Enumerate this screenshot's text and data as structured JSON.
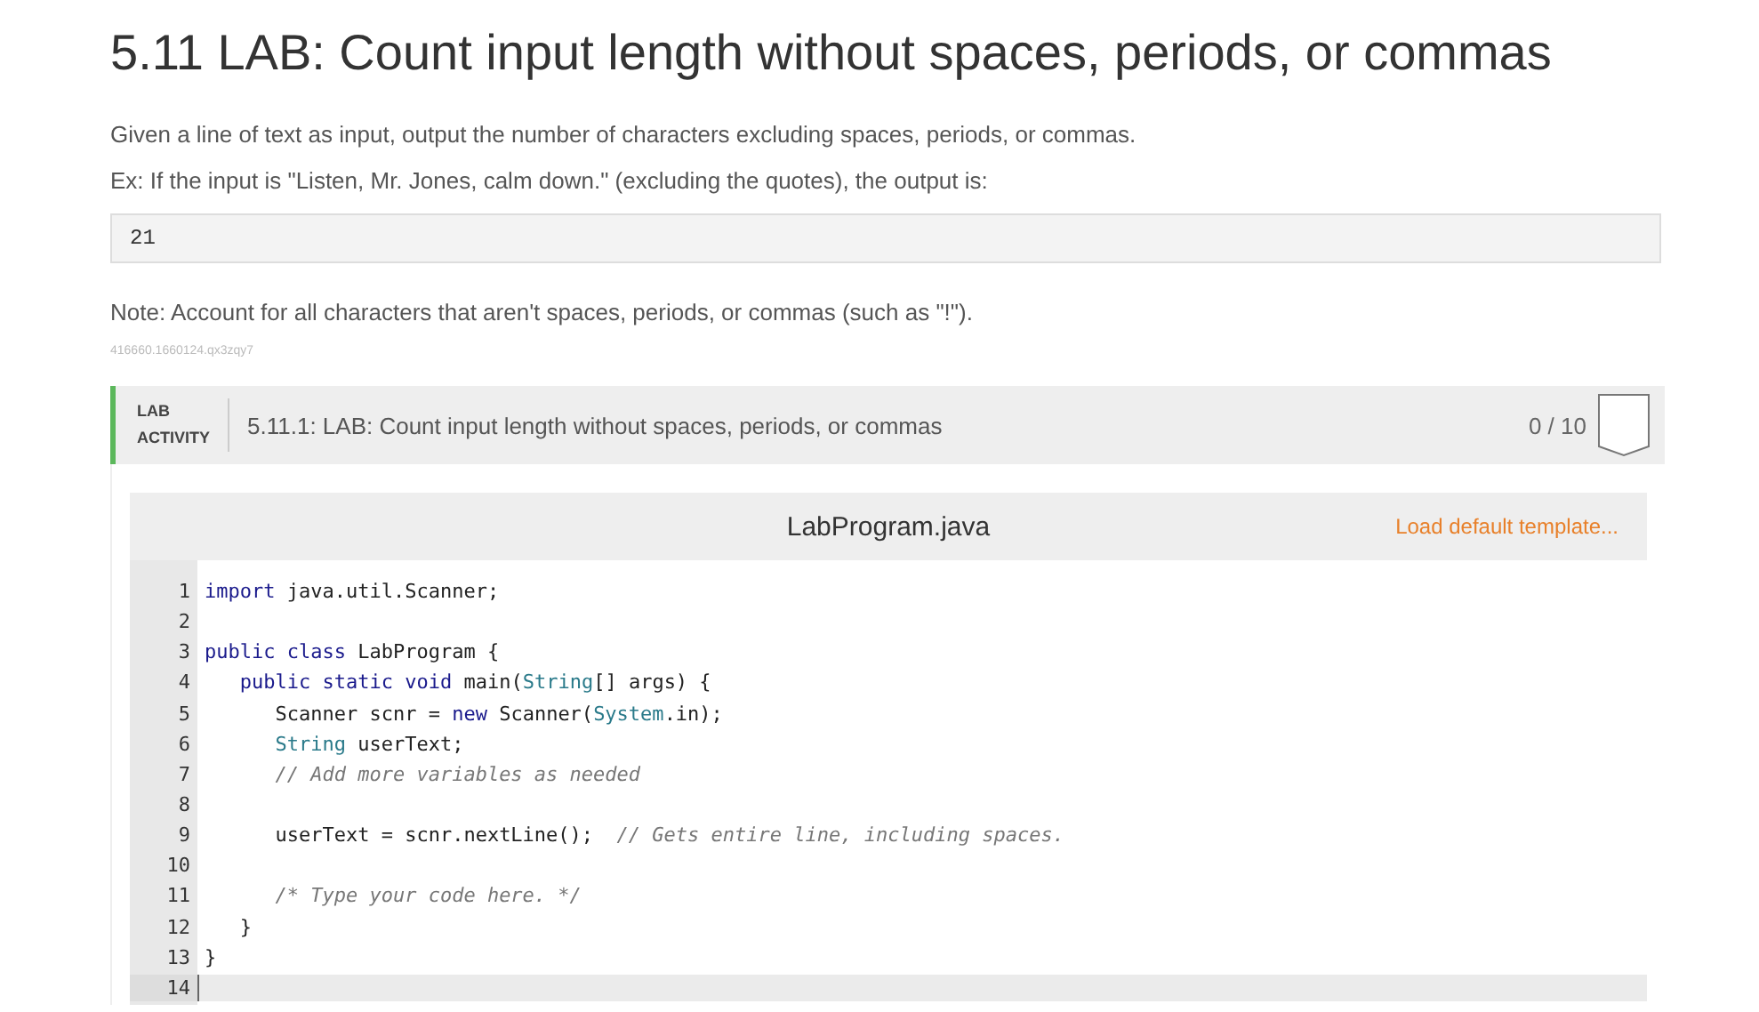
{
  "title": "5.11 LAB: Count input length without spaces, periods, or commas",
  "paragraphs": [
    "Given a line of text as input, output the number of characters excluding spaces, periods, or commas.",
    "Ex: If the input is \"Listen, Mr. Jones, calm down.\" (excluding the quotes), the output is:"
  ],
  "output_example": "21",
  "note": "Note: Account for all characters that aren't spaces, periods, or commas (such as \"!\").",
  "tracking_id": "416660.1660124.qx3zqy7",
  "lab": {
    "badge_line_1": "LAB",
    "badge_line_2": "ACTIVITY",
    "title": "5.11.1: LAB: Count input length without spaces, periods, or commas",
    "score": "0 / 10",
    "editor": {
      "filename": "LabProgram.java",
      "template_link": "Load default template...",
      "lines": [
        {
          "number": "1",
          "selected": false,
          "tokens": [
            {
              "kind": "keyword",
              "text": "import"
            },
            {
              "kind": "plain",
              "text": " java.util.Scanner;"
            }
          ]
        },
        {
          "number": "2",
          "selected": false
        },
        {
          "number": "3",
          "selected": false,
          "tokens": [
            {
              "kind": "keyword",
              "text": "public class"
            },
            {
              "kind": "plain",
              "text": " LabProgram {"
            }
          ]
        },
        {
          "number": "4",
          "selected": false,
          "tokens": [
            {
              "kind": "keyword",
              "text": "   public static void"
            },
            {
              "kind": "plain",
              "text": " main("
            },
            {
              "kind": "type",
              "text": "String"
            },
            {
              "kind": "plain",
              "text": "[] args) {"
            }
          ]
        },
        {
          "number": "5",
          "selected": false,
          "tokens": [
            {
              "kind": "plain",
              "text": "      Scanner scnr = "
            },
            {
              "kind": "keyword",
              "text": "new"
            },
            {
              "kind": "plain",
              "text": " Scanner("
            },
            {
              "kind": "type",
              "text": "System"
            },
            {
              "kind": "plain",
              "text": ".in);"
            }
          ]
        },
        {
          "number": "6",
          "selected": false,
          "tokens": [
            {
              "kind": "type",
              "text": "      String"
            },
            {
              "kind": "plain",
              "text": " userText;"
            }
          ]
        },
        {
          "number": "7",
          "selected": false,
          "tokens": [
            {
              "kind": "comment",
              "text": "      // Add more variables as needed"
            }
          ]
        },
        {
          "number": "8",
          "selected": false
        },
        {
          "number": "9",
          "selected": false,
          "tokens": [
            {
              "kind": "plain",
              "text": "      userText = scnr.nextLine();  "
            },
            {
              "kind": "comment",
              "text": "// Gets entire line, including spaces."
            }
          ]
        },
        {
          "number": "10",
          "selected": false
        },
        {
          "number": "11",
          "selected": false,
          "tokens": [
            {
              "kind": "comment",
              "text": "      /* Type your code here. */"
            }
          ]
        },
        {
          "number": "12",
          "selected": false,
          "tokens": [
            {
              "kind": "plain",
              "text": "   }"
            }
          ]
        },
        {
          "number": "13",
          "selected": false,
          "tokens": [
            {
              "kind": "plain",
              "text": "}"
            }
          ]
        },
        {
          "number": "14",
          "selected": true
        }
      ]
    }
  }
}
